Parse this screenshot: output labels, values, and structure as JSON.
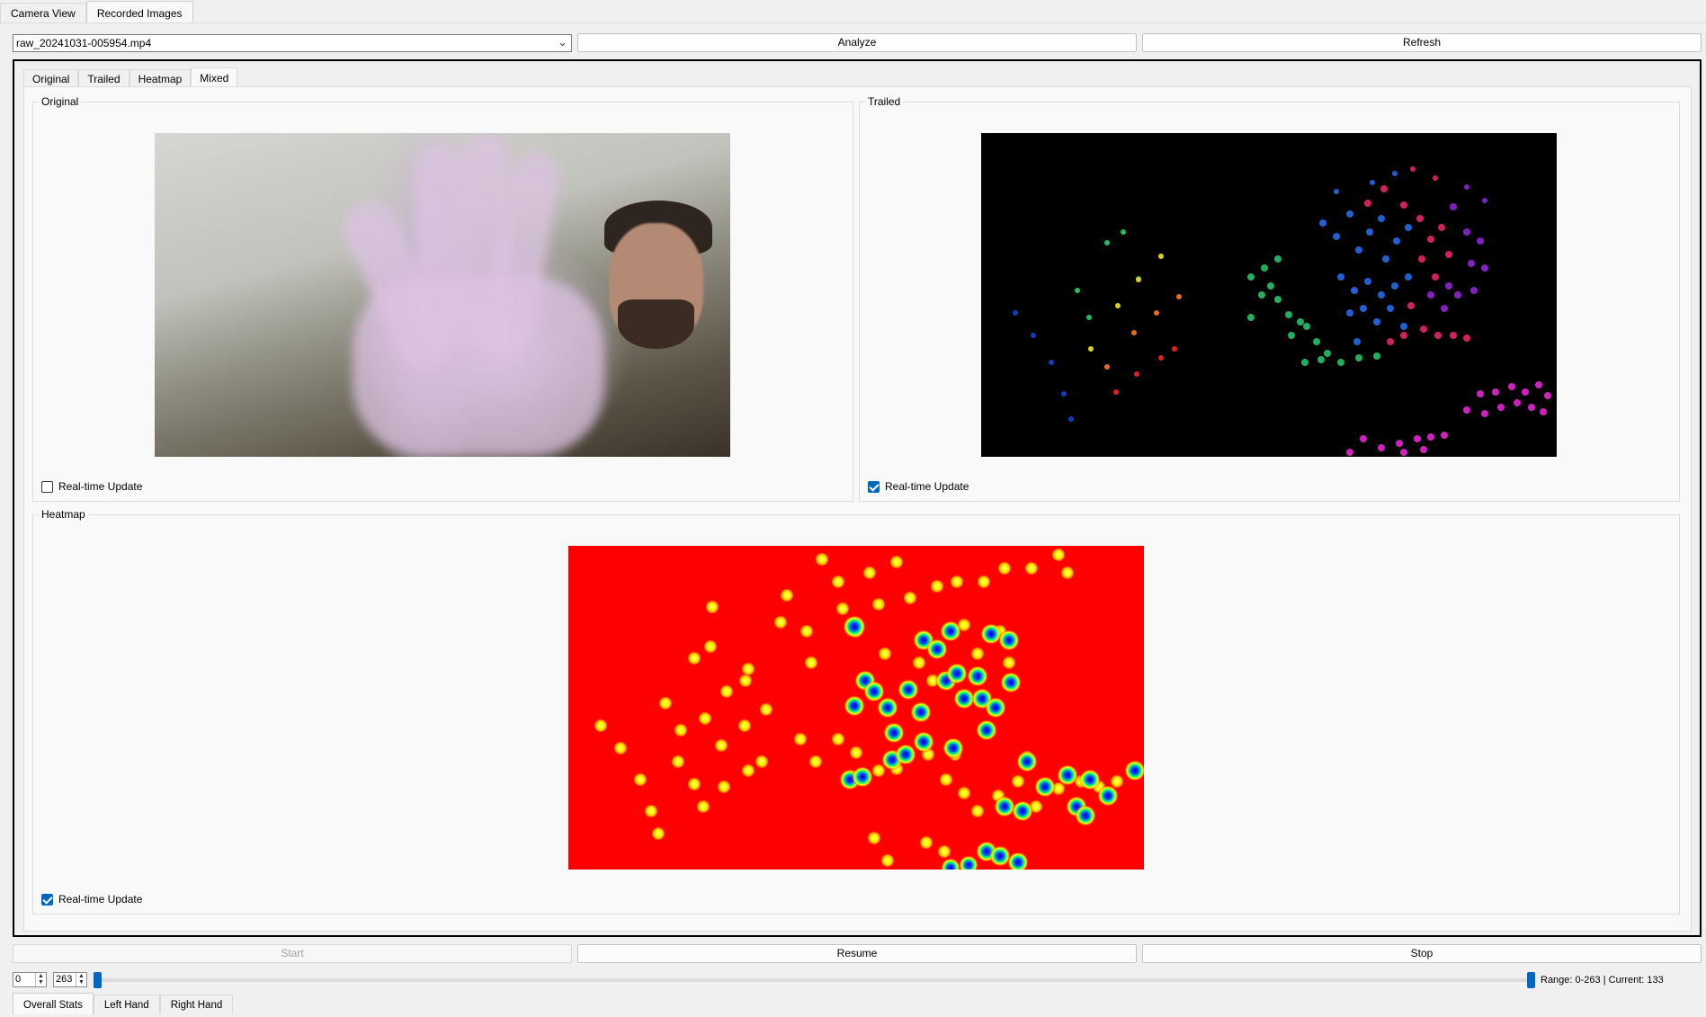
{
  "top_tabs": {
    "camera_view": "Camera View",
    "recorded_images": "Recorded Images"
  },
  "toolbar": {
    "file_selected": "raw_20241031-005954.mp4",
    "analyze_label": "Analyze",
    "refresh_label": "Refresh"
  },
  "view_tabs": {
    "original": "Original",
    "trailed": "Trailed",
    "heatmap": "Heatmap",
    "mixed": "Mixed"
  },
  "panels": {
    "original": {
      "title": "Original",
      "realtime_label": "Real-time Update",
      "realtime_checked": false
    },
    "trailed": {
      "title": "Trailed",
      "realtime_label": "Real-time Update",
      "realtime_checked": true
    },
    "heatmap": {
      "title": "Heatmap",
      "realtime_label": "Real-time Update",
      "realtime_checked": true
    }
  },
  "playback": {
    "start_label": "Start",
    "resume_label": "Resume",
    "stop_label": "Stop",
    "range_start": "0",
    "range_end": "263",
    "range_info": "Range: 0-263 | Current: 133"
  },
  "stats_tabs": {
    "overall": "Overall Stats",
    "left_hand": "Left Hand",
    "right_hand": "Right Hand"
  },
  "colors": {
    "accent": "#0067c0",
    "heat_background": "#ff0000",
    "frame_border": "#000000"
  }
}
